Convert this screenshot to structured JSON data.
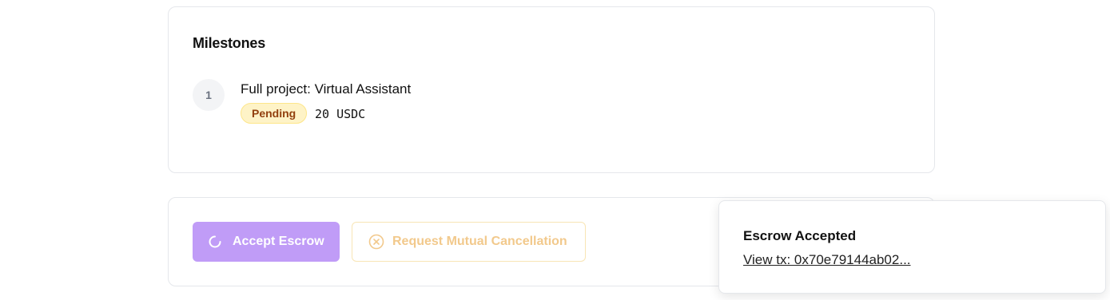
{
  "milestones": {
    "title": "Milestones",
    "items": [
      {
        "number": "1",
        "title": "Full project: Virtual Assistant",
        "status": "Pending",
        "amount": "20 USDC"
      }
    ]
  },
  "actions": {
    "accept_label": "Accept Escrow",
    "cancel_label": "Request Mutual Cancellation"
  },
  "toast": {
    "title": "Escrow Accepted",
    "link_text": "View tx: 0x70e79144ab02..."
  },
  "colors": {
    "accept_bg": "#c09cf7",
    "cancel_text": "#f2c98c",
    "pending_bg": "#fef3c7",
    "pending_text": "#92400e"
  },
  "icons": {
    "accept": "spinner-icon",
    "cancel": "x-circle-icon"
  }
}
